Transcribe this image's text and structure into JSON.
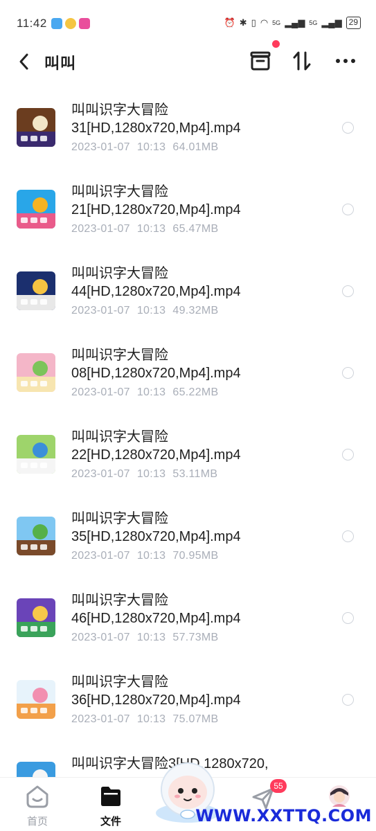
{
  "status_bar": {
    "time": "11:42",
    "network_1": "5G",
    "network_2": "5G",
    "battery": "29"
  },
  "header": {
    "title": "叫叫"
  },
  "files": [
    {
      "name": "叫叫识字大冒险31[HD,1280x720,Mp4].mp4",
      "date": "2023-01-07",
      "time": "10:13",
      "size": "64.01MB"
    },
    {
      "name": "叫叫识字大冒险21[HD,1280x720,Mp4].mp4",
      "date": "2023-01-07",
      "time": "10:13",
      "size": "65.47MB"
    },
    {
      "name": "叫叫识字大冒险44[HD,1280x720,Mp4].mp4",
      "date": "2023-01-07",
      "time": "10:13",
      "size": "49.32MB"
    },
    {
      "name": "叫叫识字大冒险08[HD,1280x720,Mp4].mp4",
      "date": "2023-01-07",
      "time": "10:13",
      "size": "65.22MB"
    },
    {
      "name": "叫叫识字大冒险22[HD,1280x720,Mp4].mp4",
      "date": "2023-01-07",
      "time": "10:13",
      "size": "53.11MB"
    },
    {
      "name": "叫叫识字大冒险35[HD,1280x720,Mp4].mp4",
      "date": "2023-01-07",
      "time": "10:13",
      "size": "70.95MB"
    },
    {
      "name": "叫叫识字大冒险46[HD,1280x720,Mp4].mp4",
      "date": "2023-01-07",
      "time": "10:13",
      "size": "57.73MB"
    },
    {
      "name": "叫叫识字大冒险36[HD,1280x720,Mp4].mp4",
      "date": "2023-01-07",
      "time": "10:13",
      "size": "75.07MB"
    },
    {
      "name": "叫叫识字大冒险3[HD,1280x720,",
      "date": "",
      "time": "",
      "size": ""
    }
  ],
  "thumb_colors": [
    [
      "#6b3d1f",
      "#f2e6c8",
      "#3a2a6e"
    ],
    [
      "#29a6e8",
      "#f5b321",
      "#e95b8a"
    ],
    [
      "#1b2f6e",
      "#f5c342",
      "#e8e8e8"
    ],
    [
      "#f4b6c8",
      "#7cc45a",
      "#f7e5b0"
    ],
    [
      "#9ed46b",
      "#3b8fd9",
      "#f5f5f5"
    ],
    [
      "#7fc7f2",
      "#56b049",
      "#7a4a2a"
    ],
    [
      "#6a44b8",
      "#f7c84a",
      "#3aa35a"
    ],
    [
      "#e7f3fb",
      "#f28fb0",
      "#f2a04a"
    ],
    [
      "#3a9be0",
      "#f6f6f6",
      "#8fcf6b"
    ]
  ],
  "nav": {
    "home": "首页",
    "files": "文件",
    "share_badge": "55"
  },
  "watermark": "WWW.XXTTQ.COM",
  "colors": {
    "accent_red": "#ff3b5c",
    "meta_gray": "#a9aeb8",
    "watermark_blue": "#1a2bd9"
  }
}
